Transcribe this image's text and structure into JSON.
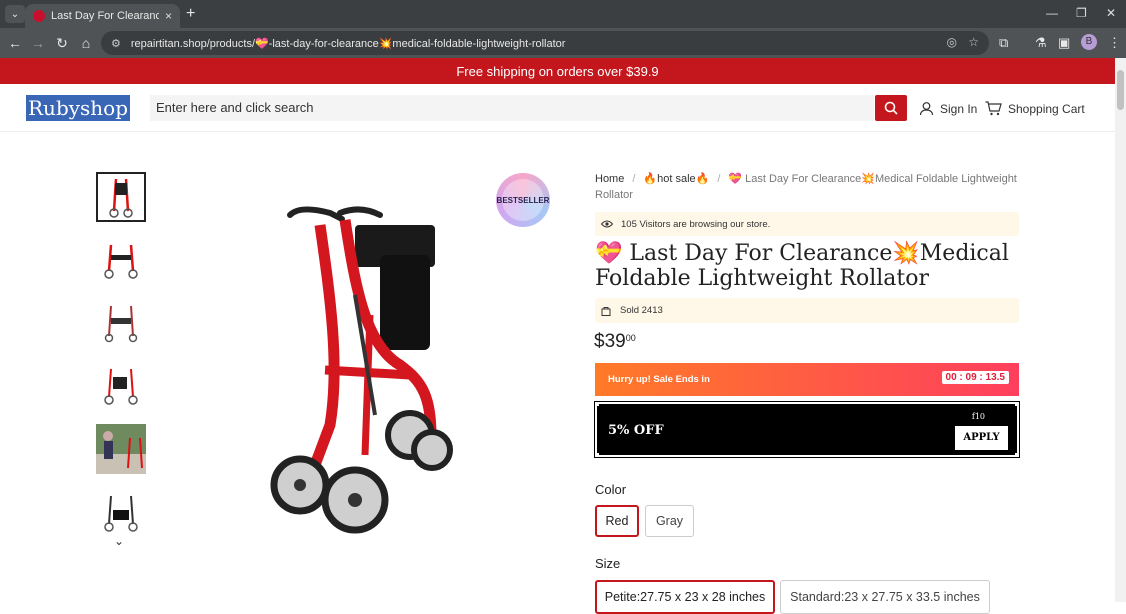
{
  "browser": {
    "tab_title": "Last Day For Clearance Medical",
    "tab_close": "×",
    "new_tab": "+",
    "url": "repairtitan.shop/products/💝-last-day-for-clearance💥medical-foldable-lightweight-rollator",
    "profile_initial": "B"
  },
  "promo": {
    "text": "Free shipping on orders over $39.9"
  },
  "header": {
    "logo": "Rubyshop",
    "search_placeholder": "Enter here and click search",
    "sign_in": "Sign In",
    "cart": "Shopping Cart"
  },
  "badge": {
    "line1": "BEST",
    "line2": "SELLER"
  },
  "breadcrumb": {
    "home": "Home",
    "hot_sale": "🔥hot sale🔥",
    "current": "💝 Last Day For Clearance💥Medical Foldable Lightweight Rollator"
  },
  "product": {
    "visitors": "105 Visitors are browsing our store.",
    "title": "💝 Last Day For Clearance💥Medical Foldable Lightweight Rollator",
    "sold": "Sold 2413",
    "price_main": "$39",
    "price_cents": "00",
    "hurry": "Hurry up! Sale Ends in",
    "timer": "00 : 09 : 13.5",
    "coupon_off": "5% OFF",
    "coupon_code": "f10",
    "coupon_apply": "APPLY"
  },
  "options": {
    "color_label": "Color",
    "colors": [
      "Red",
      "Gray"
    ],
    "size_label": "Size",
    "sizes": [
      "Petite:27.75 x 23 x 28 inches",
      "Standard:23 x 27.75 x 33.5 inches"
    ]
  },
  "icons": {
    "tab_menu": "chevron-down-icon",
    "back": "arrow-left-icon",
    "forward": "arrow-right-icon",
    "reload": "reload-icon",
    "home": "home-icon"
  },
  "colors": {
    "brand_red": "#c4171d",
    "logo_blue": "#3a67b5"
  }
}
